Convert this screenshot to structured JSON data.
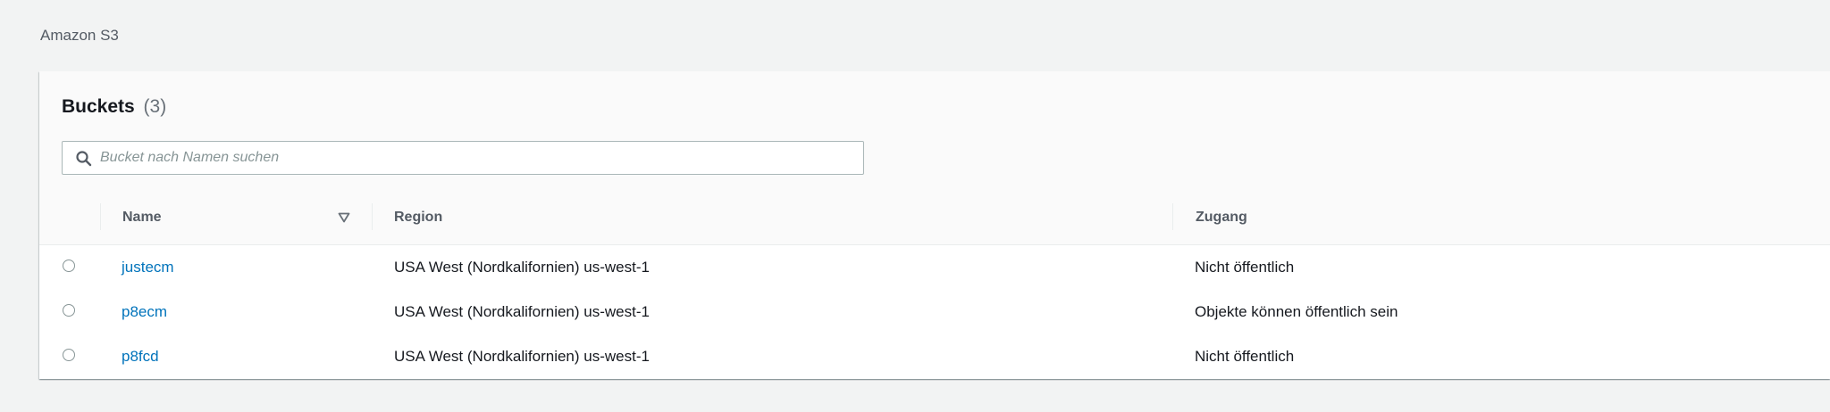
{
  "breadcrumb": "Amazon S3",
  "buckets_panel": {
    "title": "Buckets",
    "count": "(3)",
    "search_placeholder": "Bucket nach Namen suchen",
    "columns": {
      "name": "Name",
      "region": "Region",
      "access": "Zugang"
    },
    "rows": [
      {
        "name": "justecm",
        "region": "USA West (Nordkalifornien) us-west-1",
        "access": "Nicht öffentlich"
      },
      {
        "name": "p8ecm",
        "region": "USA West (Nordkalifornien) us-west-1",
        "access": "Objekte können öffentlich sein"
      },
      {
        "name": "p8fcd",
        "region": "USA West (Nordkalifornien) us-west-1",
        "access": "Nicht öffentlich"
      }
    ]
  },
  "icons": {
    "search": "search-icon",
    "sort": "sort-descending-icon"
  },
  "colors": {
    "link": "#0073bb",
    "background": "#f2f3f3"
  }
}
